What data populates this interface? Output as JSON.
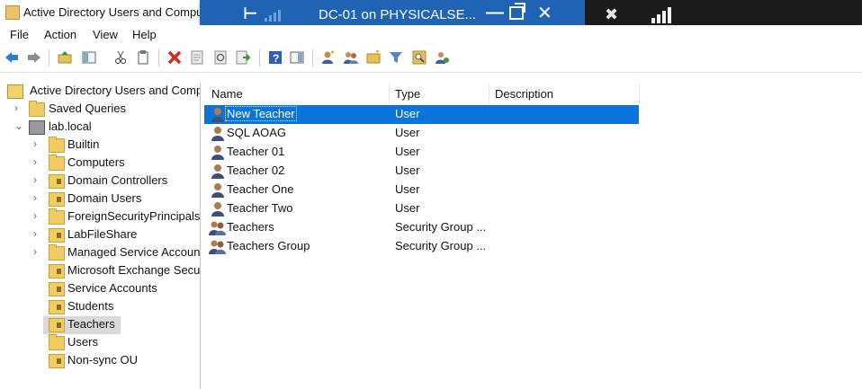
{
  "window": {
    "title": "Active Directory Users and Computers"
  },
  "remote_bar": {
    "title": "DC-01 on PHYSICALSE..."
  },
  "menu": [
    {
      "label": "File"
    },
    {
      "label": "Action"
    },
    {
      "label": "View"
    },
    {
      "label": "Help"
    }
  ],
  "toolbar": [
    "back-arrow-icon",
    "forward-arrow-icon",
    "up-folder-icon",
    "show-console-tree-icon",
    "cut-icon",
    "copy-icon",
    "delete-icon",
    "properties-icon",
    "refresh-icon",
    "export-list-icon",
    "help-icon",
    "action-pane-icon",
    "new-user-icon",
    "new-group-icon",
    "new-ou-icon",
    "filter-icon",
    "find-icon",
    "add-to-group-icon"
  ],
  "tree": {
    "root_label": "Active Directory Users and Computers",
    "items": [
      {
        "label": "Saved Queries"
      },
      {
        "label": "lab.local"
      },
      {
        "label": "Builtin"
      },
      {
        "label": "Computers"
      },
      {
        "label": "Domain Controllers"
      },
      {
        "label": "Domain Users"
      },
      {
        "label": "ForeignSecurityPrincipals"
      },
      {
        "label": "LabFileShare"
      },
      {
        "label": "Managed Service Accounts"
      },
      {
        "label": "Microsoft Exchange Security Groups"
      },
      {
        "label": "Service Accounts"
      },
      {
        "label": "Students"
      },
      {
        "label": "Teachers"
      },
      {
        "label": "Users"
      },
      {
        "label": "Non-sync OU"
      }
    ]
  },
  "list": {
    "columns": [
      {
        "label": "Name"
      },
      {
        "label": "Type"
      },
      {
        "label": "Description"
      }
    ],
    "rows": [
      {
        "name": "New Teacher",
        "type": "User",
        "icon": "user-icon"
      },
      {
        "name": "SQL AOAG",
        "type": "User",
        "icon": "user-icon"
      },
      {
        "name": "Teacher 01",
        "type": "User",
        "icon": "user-icon"
      },
      {
        "name": "Teacher 02",
        "type": "User",
        "icon": "user-icon"
      },
      {
        "name": "Teacher One",
        "type": "User",
        "icon": "user-icon"
      },
      {
        "name": "Teacher Two",
        "type": "User",
        "icon": "user-icon"
      },
      {
        "name": "Teachers",
        "type": "Security Group ...",
        "icon": "group-icon"
      },
      {
        "name": "Teachers Group",
        "type": "Security Group ...",
        "icon": "group-icon"
      }
    ]
  },
  "colors": {
    "selection": "#0a74da",
    "remote_bar": "#1f63b5",
    "folder": "#f0cd64"
  }
}
